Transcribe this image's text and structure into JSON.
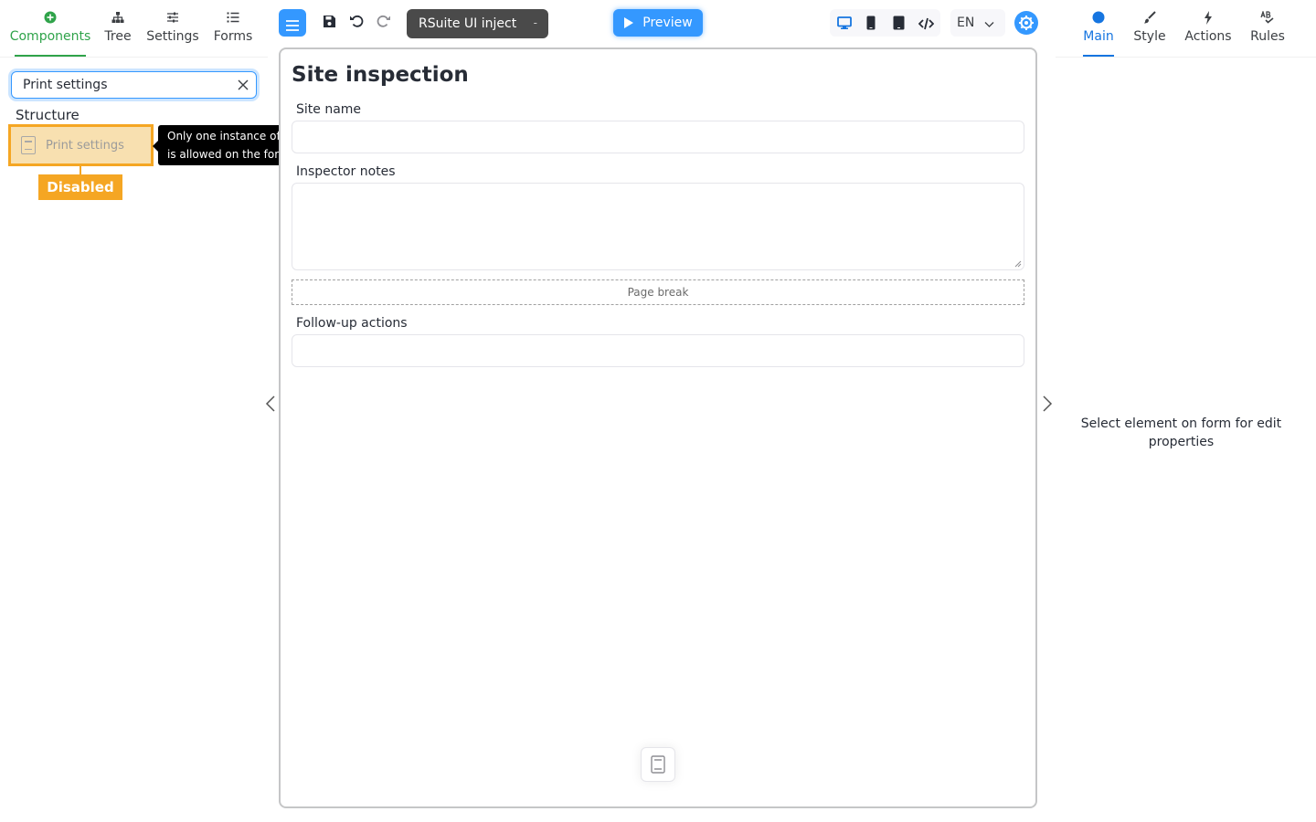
{
  "left_tabs": {
    "components": "Components",
    "tree": "Tree",
    "settings": "Settings",
    "forms": "Forms"
  },
  "search": {
    "value": "Print settings"
  },
  "structure": {
    "title": "Structure",
    "item_label": "Print settings",
    "disabled_badge": "Disabled",
    "tooltip": "Only one instance of this component is allowed on the form."
  },
  "toolbar": {
    "theme": "RSuite UI inject",
    "theme_caret": "-",
    "preview": "Preview",
    "language": "EN"
  },
  "form": {
    "title": "Site inspection",
    "fields": {
      "site_name": "Site name",
      "inspector_notes": "Inspector notes",
      "page_break": "Page break",
      "follow_up": "Follow-up actions"
    }
  },
  "right_tabs": {
    "main": "Main",
    "style": "Style",
    "actions": "Actions",
    "rules": "Rules"
  },
  "properties": {
    "empty_message": "Select element on form for edit properties"
  },
  "colors": {
    "accent": "#3498ff",
    "components_active": "#2fa34a",
    "main_active": "#1675e0",
    "disabled": "#f5a623"
  }
}
